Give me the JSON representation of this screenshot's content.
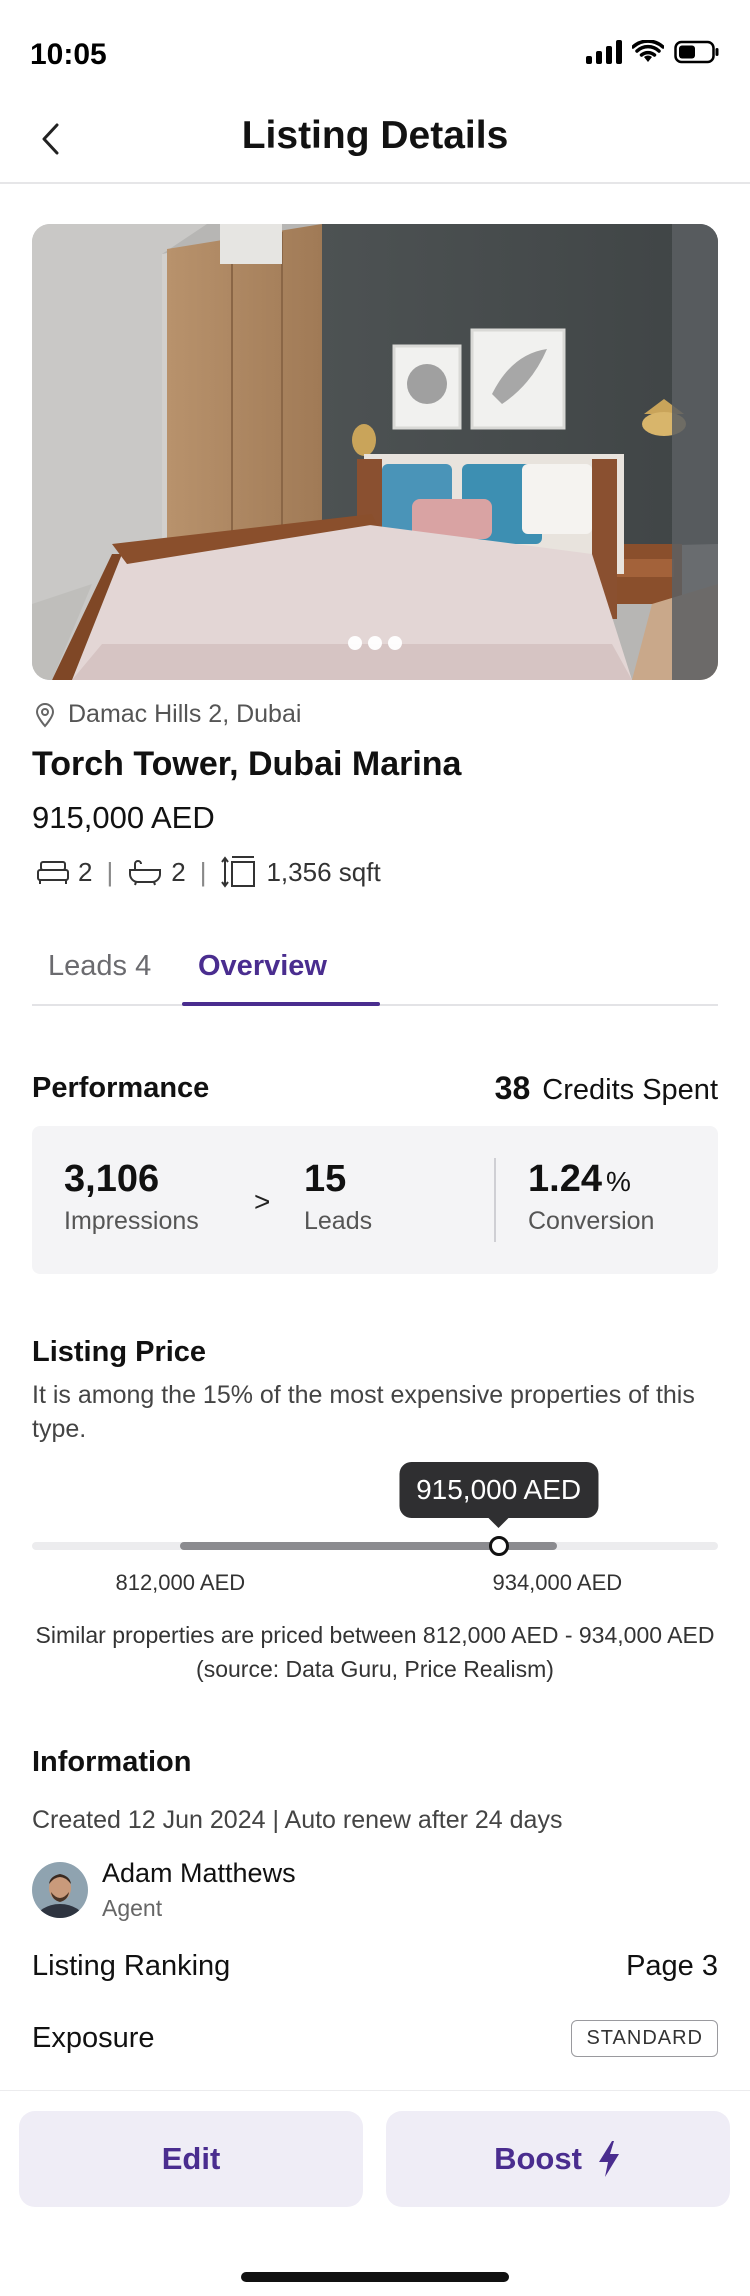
{
  "status_bar": {
    "time": "10:05"
  },
  "nav": {
    "title": "Listing Details"
  },
  "listing": {
    "location": "Damac Hills 2, Dubai",
    "title": "Torch Tower, Dubai Marina",
    "price": "915,000 AED",
    "bedrooms": "2",
    "bathrooms": "2",
    "area": "1,356 sqft"
  },
  "tabs": {
    "leads": "Leads 4",
    "overview": "Overview",
    "active": "overview"
  },
  "performance": {
    "title": "Performance",
    "credits_value": "38",
    "credits_label": "Credits Spent",
    "impressions_value": "3,106",
    "impressions_label": "Impressions",
    "arrow": ">",
    "leads_value": "15",
    "leads_label": "Leads",
    "conversion_value": "1.24",
    "conversion_unit": "%",
    "conversion_label": "Conversion"
  },
  "listing_price": {
    "title": "Listing Price",
    "description": "It is among the 15% of the most expensive properties of this type.",
    "current_label": "915,000 AED",
    "current_value": 915000,
    "min_label": "812,000 AED",
    "min_value": 812000,
    "max_label": "934,000 AED",
    "max_value": 934000,
    "similar_text": "Similar properties are priced between 812,000 AED - 934,000 AED (source: Data Guru, Price Realism)"
  },
  "information": {
    "title": "Information",
    "created": "Created 12 Jun 2024 | Auto renew after 24 days",
    "agent_name": "Adam Matthews",
    "agent_role": "Agent",
    "ranking_label": "Listing Ranking",
    "ranking_value": "Page 3",
    "exposure_label": "Exposure",
    "exposure_value": "STANDARD"
  },
  "actions": {
    "edit": "Edit",
    "boost": "Boost"
  },
  "colors": {
    "accent": "#4a2d8f",
    "button_bg": "#efedf6"
  },
  "icons": [
    "back-chevron-icon",
    "location-pin-icon",
    "bed-icon",
    "bath-icon",
    "area-icon",
    "bolt-icon",
    "signal-icon",
    "wifi-icon",
    "battery-icon"
  ]
}
